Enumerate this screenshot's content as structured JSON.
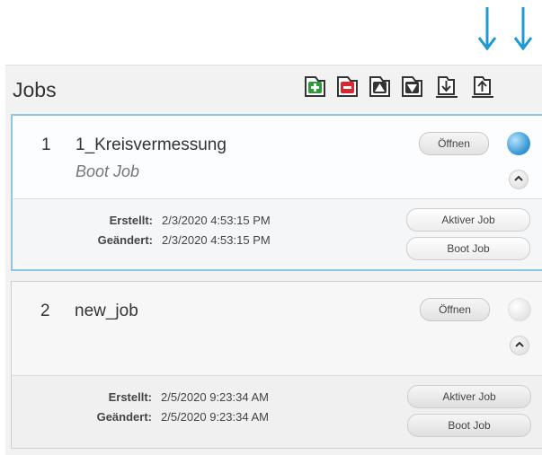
{
  "panel": {
    "title": "Jobs"
  },
  "toolbar": {
    "buttons": [
      {
        "name": "add-job",
        "icon": "plus-icon",
        "color": "#2e9b3a"
      },
      {
        "name": "remove-job",
        "icon": "minus-icon",
        "color": "#d8282f"
      },
      {
        "name": "move-up",
        "icon": "triangle-up-icon"
      },
      {
        "name": "move-down",
        "icon": "triangle-down-icon"
      },
      {
        "name": "import-job",
        "icon": "download-icon"
      },
      {
        "name": "export-job",
        "icon": "upload-icon"
      }
    ],
    "callout_color": "#1c9ad6"
  },
  "jobs": [
    {
      "number": "1",
      "name": "1_Kreisvermessung",
      "subtitle": "Boot Job",
      "open_label": "Öffnen",
      "status": "active",
      "created_label": "Erstellt:",
      "created_value": "2/3/2020 4:53:15 PM",
      "modified_label": "Geändert:",
      "modified_value": "2/3/2020 4:53:15 PM",
      "active_job_label": "Aktiver Job",
      "boot_job_label": "Boot Job"
    },
    {
      "number": "2",
      "name": "new_job",
      "subtitle": "",
      "open_label": "Öffnen",
      "status": "inactive",
      "created_label": "Erstellt:",
      "created_value": "2/5/2020 9:23:34 AM",
      "modified_label": "Geändert:",
      "modified_value": "2/5/2020 9:23:34 AM",
      "active_job_label": "Aktiver Job",
      "boot_job_label": "Boot Job"
    }
  ]
}
